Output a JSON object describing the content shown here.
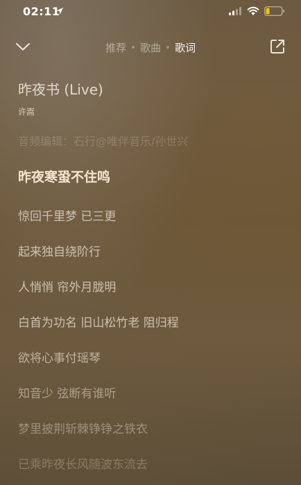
{
  "status_bar": {
    "time": "02:11",
    "icons": [
      "location-arrow-icon",
      "signal-icon",
      "wifi-icon",
      "battery-icon"
    ],
    "battery_color": "#f5c400"
  },
  "header": {
    "collapse_icon": "chevron-down-icon",
    "tabs": [
      {
        "label": "推荐",
        "active": false
      },
      {
        "label": "歌曲",
        "active": false
      },
      {
        "label": "歌词",
        "active": true
      }
    ],
    "share_icon": "share-icon"
  },
  "song": {
    "title": "昨夜书 (Live)",
    "artist": "许嵩",
    "credit": "音频编辑：石行@唯伴音乐/孙世兴"
  },
  "lyrics": {
    "current_index": 0,
    "lines": [
      "昨夜寒蛩不住鸣",
      "惊回千里梦 已三更",
      "起来独自绕阶行",
      "人悄悄 帘外月胧明",
      "白首为功名 旧山松竹老 阻归程",
      "欲将心事付瑶琴",
      "知音少 弦断有谁听",
      "梦里披荆斩棘铮铮之铁衣",
      "已乘昨夜长风随波东流去"
    ]
  },
  "colors": {
    "background": "#6a5a44",
    "current_lyric": "#f7e4cf",
    "lyric": "#efe6da"
  }
}
